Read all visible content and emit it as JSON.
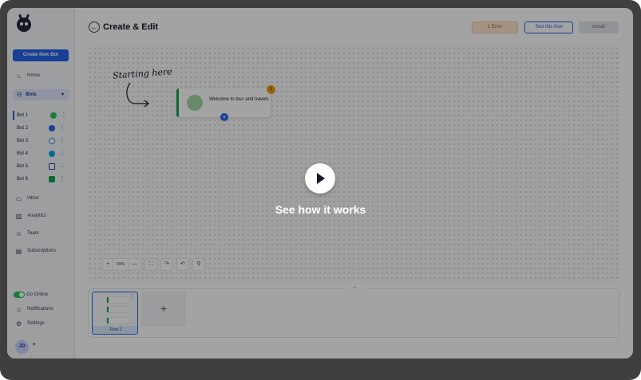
{
  "sidebar": {
    "new_bot_label": "Create New Bot",
    "nav": [
      {
        "label": "Home",
        "icon": "home-icon"
      },
      {
        "label": "Inbox",
        "icon": "inbox-icon"
      },
      {
        "label": "Analytics",
        "icon": "analytics-icon"
      },
      {
        "label": "Team",
        "icon": "team-icon"
      },
      {
        "label": "Subscriptions",
        "icon": "subscriptions-icon"
      }
    ],
    "bots_label": "Bots",
    "bots": [
      {
        "label": "Bot 1",
        "channel": "whatsapp-icon",
        "color": "#22c55e"
      },
      {
        "label": "Bot 2",
        "channel": "facebook-icon",
        "color": "#2563eb"
      },
      {
        "label": "Bot 3",
        "channel": "web-icon",
        "color": "#3b82f6"
      },
      {
        "label": "Bot 4",
        "channel": "telegram-icon",
        "color": "#0ea5e9"
      },
      {
        "label": "Bot 5",
        "channel": "widget-icon",
        "color": "#1e40af"
      },
      {
        "label": "Bot 6",
        "channel": "chat-icon",
        "color": "#16a34a"
      }
    ],
    "go_online_label": "Go Online",
    "notifications_label": "Notifications",
    "settings_label": "Settings",
    "avatar_initials": "JD"
  },
  "header": {
    "title": "Create & Edit",
    "error_label": "1 Error",
    "test_label": "Test this flow",
    "install_label": "Install"
  },
  "canvas": {
    "hint": "Starting here",
    "node_text": "Welcome to tour and travels",
    "zoom": "69%"
  },
  "flows": {
    "items": [
      {
        "label": "Flow 1"
      }
    ]
  },
  "overlay": {
    "text": "See how it works"
  },
  "colors": {
    "accent": "#2563eb",
    "success": "#16a34a",
    "warning": "#f59e0b"
  }
}
